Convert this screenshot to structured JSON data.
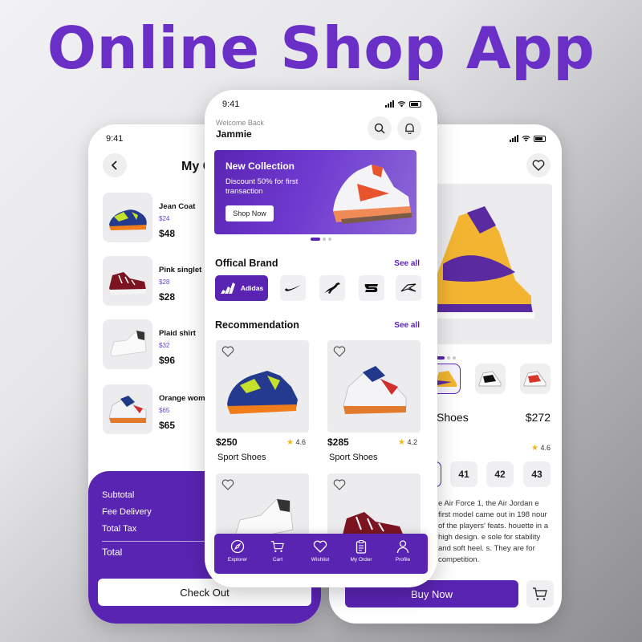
{
  "hero": {
    "title": "Online Shop App"
  },
  "status": {
    "time": "9:41"
  },
  "cart_screen": {
    "title": "My Cart",
    "items": [
      {
        "name": "Jean Coat",
        "size": "$24",
        "price": "$48"
      },
      {
        "name": "Pink singlet",
        "size": "$28",
        "price": "$28"
      },
      {
        "name": "Plaid shirt",
        "size": "$32",
        "price": "$96"
      },
      {
        "name": "Orange women",
        "size": "$65",
        "price": "$65"
      }
    ],
    "summary": {
      "subtotal_label": "Subtotal",
      "fee_label": "Fee Delivery",
      "tax_label": "Total Tax",
      "total_label": "Total"
    },
    "checkout_label": "Check Out"
  },
  "home_screen": {
    "welcome": "Welcome Back",
    "user": "Jammie",
    "banner": {
      "title": "New Collection",
      "subtitle": "Discount 50% for first transaction",
      "button": "Shop Now"
    },
    "brands_title": "Offical Brand",
    "brands_see_all": "See all",
    "brands": [
      {
        "name": "Adidas",
        "icon": "adidas-icon"
      },
      {
        "name": "",
        "icon": "nike-icon"
      },
      {
        "name": "",
        "icon": "puma-icon"
      },
      {
        "name": "",
        "icon": "skechers-icon"
      },
      {
        "name": "",
        "icon": "reebok-icon"
      }
    ],
    "rec_title": "Recommendation",
    "rec_see_all": "See all",
    "products": [
      {
        "price": "$250",
        "rating": "4.6",
        "name": "Sport Shoes"
      },
      {
        "price": "$285",
        "rating": "4.2",
        "name": "Sport Shoes"
      },
      {
        "price": "",
        "rating": "",
        "name": ""
      },
      {
        "price": "",
        "rating": "",
        "name": ""
      }
    ],
    "nav": [
      {
        "label": "Explorer",
        "icon": "compass-icon"
      },
      {
        "label": "Cart",
        "icon": "cart-icon"
      },
      {
        "label": "Wishlist",
        "icon": "heart-icon"
      },
      {
        "label": "My Order",
        "icon": "clipboard-icon"
      },
      {
        "label": "Profile",
        "icon": "user-icon"
      }
    ]
  },
  "detail_screen": {
    "name": "Shoes",
    "price": "$272",
    "rating": "4.6",
    "sizes": [
      "",
      "41",
      "42",
      "43"
    ],
    "description": "e Air Force 1, the Air Jordan e first model came out in 198 nour of the players' feats. houette in a high design. e sole for stability and soft heel. s. They are for competition.",
    "buy_label": "Buy Now"
  },
  "colors": {
    "accent": "#5a24b3",
    "title": "#6a2fc7",
    "star": "#f3b51a"
  }
}
